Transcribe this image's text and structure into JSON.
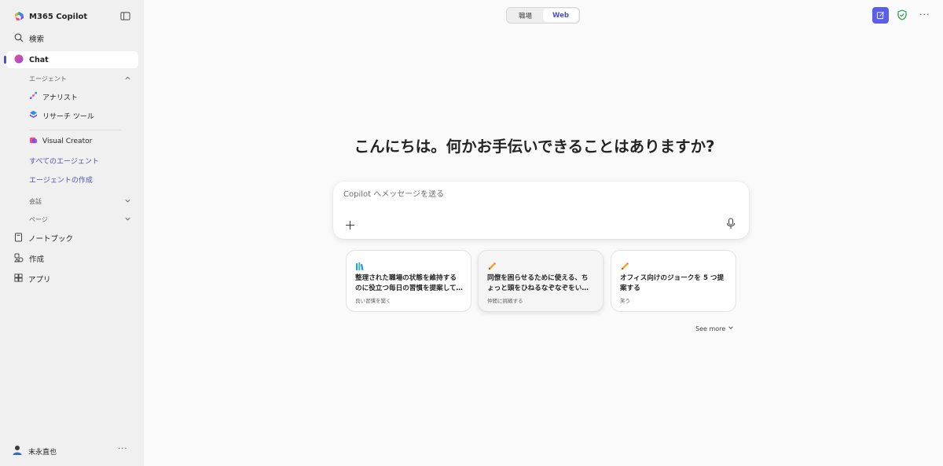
{
  "app": {
    "title": "M365 Copilot"
  },
  "sidebar": {
    "search_label": "検索",
    "chat_label": "Chat",
    "agents_section": "エージェント",
    "agents": [
      {
        "label": "アナリスト",
        "icon": "analyst-icon"
      },
      {
        "label": "リサーチ ツール",
        "icon": "research-icon"
      },
      {
        "label": "Visual Creator",
        "icon": "visual-creator-icon"
      }
    ],
    "all_agents_link": "すべてのエージェント",
    "create_agent_link": "エージェントの作成",
    "conversations_section": "会話",
    "pages_section": "ページ",
    "notebook_label": "ノートブック",
    "create_label": "作成",
    "apps_label": "アプリ",
    "user_name": "末永直也",
    "more_label": "···"
  },
  "topbar": {
    "tabs": [
      {
        "label": "職場",
        "selected": false
      },
      {
        "label": "Web",
        "selected": true
      }
    ],
    "more_label": "···"
  },
  "main": {
    "greeting": "こんにちは。何かお手伝いできることはありますか?",
    "composer_placeholder": "Copilot へメッセージを送る",
    "plus_label": "+",
    "see_more": "See more",
    "see_more_chevron": "⌄"
  },
  "prompts": [
    {
      "title": "整理された職場の状態を維持するのに役立つ毎日の習慣を提案してください",
      "subtitle": "良い習慣を築く",
      "icon": "books-icon"
    },
    {
      "title": "同僚を困らせるために使える、ちょっと頭をひねるなぞなぞをいくつか教えて",
      "subtitle": "仲間に挑戦する",
      "icon": "pencil-icon"
    },
    {
      "title": "オフィス向けのジョークを 5 つ提案する",
      "subtitle": "笑う",
      "icon": "pencil-icon"
    }
  ],
  "colors": {
    "accent": "#4f52b2",
    "new_chat_button": "#5b5fe6",
    "sidebar_bg": "#f0f0f0",
    "page_bg": "#fafafa"
  }
}
